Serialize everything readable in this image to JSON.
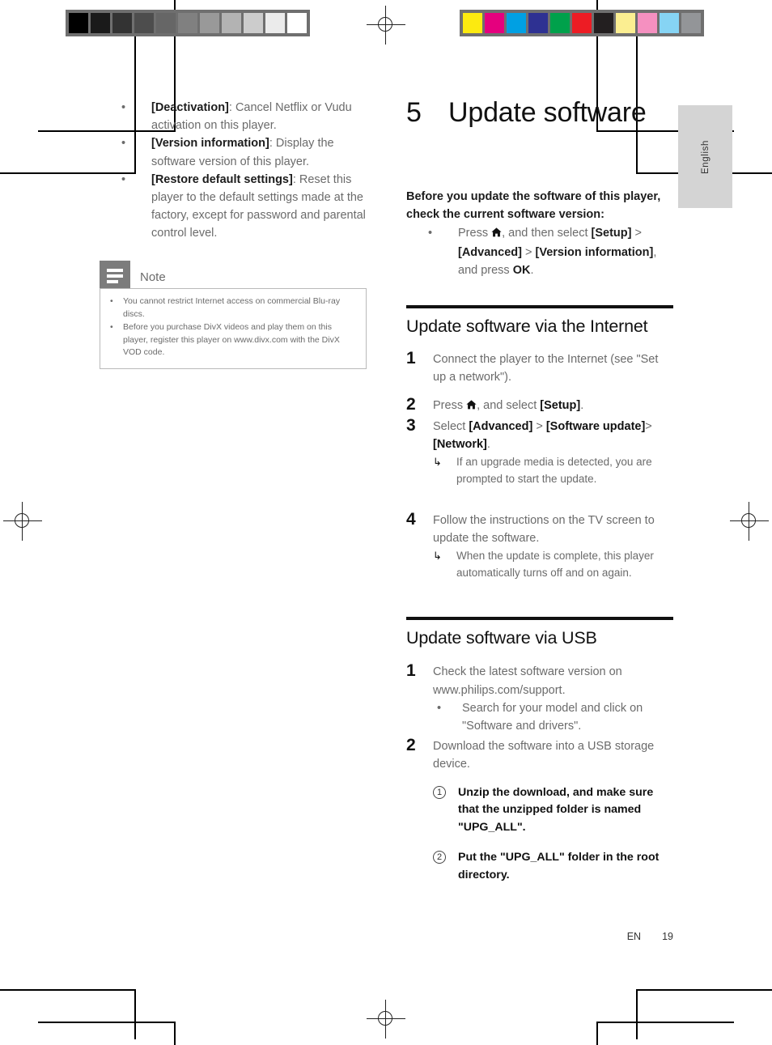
{
  "page": {
    "footer_lang": "EN",
    "footer_number": "19",
    "side_tab": "English"
  },
  "marks": {
    "grayscale_swatches": [
      "#000000",
      "#1a1a1a",
      "#333333",
      "#4d4d4d",
      "#666666",
      "#808080",
      "#999999",
      "#b3b3b3",
      "#cccccc",
      "#ebebeb",
      "#ffffff"
    ],
    "color_swatches": [
      "#fcea10",
      "#e5007e",
      "#00a0e3",
      "#2e3192",
      "#00a14b",
      "#ed1c24",
      "#231f20",
      "#fbee91",
      "#f590c0",
      "#86d4f4",
      "#939598"
    ],
    "registration_icon": "registration-crosshair-icon"
  },
  "left_column": {
    "settings_bullets": [
      {
        "bullet": "•",
        "term": "[Deactivation]",
        "text": ": Cancel Netflix or Vudu activation on this player."
      },
      {
        "bullet": "•",
        "term": "[Version information]",
        "text": ": Display the software version of this player."
      },
      {
        "bullet": "•",
        "term": "[Restore default settings]",
        "text": ": Reset this player to the default settings made at the factory, except for password and parental control level."
      }
    ],
    "note": {
      "icon": "note-lines-icon",
      "title": "Note",
      "items": [
        "You cannot restrict Internet access on commercial Blu-ray discs.",
        "Before you purchase DivX videos and play them on this player, register this player on www.divx.com with the DivX VOD code."
      ],
      "bullet": "•"
    }
  },
  "right_column": {
    "chapter_number": "5",
    "chapter_title": "Update software",
    "intro_lead": "Before you update the software of this player, check the current software version:",
    "intro_bullet": {
      "bullet": "•",
      "part1": "Press ",
      "icon": "home-icon",
      "part2": ", and then select ",
      "b1": "[Setup]",
      "sep1": " > ",
      "b2": "[Advanced]",
      "sep2": " > ",
      "b3": "[Version information]",
      "part3": ", and press ",
      "b4": "OK",
      "end": "."
    },
    "section_internet": {
      "title": "Update software via the Internet",
      "steps": [
        {
          "num": "1",
          "text": "Connect the player to the Internet (see \"Set up a network\")."
        },
        {
          "num": "2",
          "pre": "Press ",
          "icon": "home-icon",
          "mid": ", and select ",
          "bold": "[Setup]",
          "post": "."
        },
        {
          "num": "3",
          "pre": "Select ",
          "b1": "[Advanced]",
          "sep": " > ",
          "b2": "[Software update]",
          "sep2": ">",
          "b3": "[Network]",
          "post": ".",
          "sub_arrow": "↳",
          "sub_text": "If an upgrade media is detected, you are prompted to start the update."
        },
        {
          "num": "4",
          "text": "Follow the instructions on the TV screen to update the software.",
          "sub_arrow": "↳",
          "sub_text": "When the update is complete, this player automatically turns off and on again."
        }
      ]
    },
    "section_usb": {
      "title": "Update software via USB",
      "steps": [
        {
          "num": "1",
          "text": "Check the latest software version on www.philips.com/support.",
          "sub_bullet": "•",
          "sub_text": "Search for your model and click on \"Software and drivers\"."
        },
        {
          "num": "2",
          "text": "Download the software into a USB storage device.",
          "circled": [
            {
              "num": "1",
              "text": "Unzip the download, and make sure that the unzipped folder is named \"UPG_ALL\"."
            },
            {
              "num": "2",
              "text": "Put the \"UPG_ALL\" folder in the root directory."
            }
          ]
        }
      ]
    }
  }
}
